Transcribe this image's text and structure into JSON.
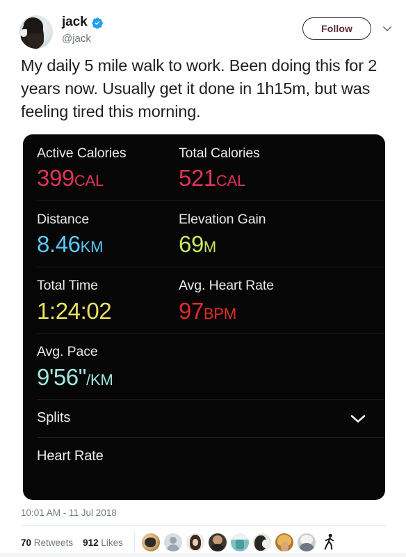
{
  "author": {
    "display_name": "jack",
    "handle": "@jack",
    "verified": true,
    "verified_color": "#1da1f2"
  },
  "follow": {
    "label": "Follow",
    "text_color": "#5a2831"
  },
  "tweet": {
    "text": "My daily 5 mile walk to work. Been doing this for 2 years now. Usually get it done in 1h15m, but was feeling tired this morning.",
    "timestamp": "10:01 AM - 11 Jul 2018"
  },
  "engagement": {
    "retweets_count": "70",
    "retweets_label": "Retweets",
    "likes_count": "912",
    "likes_label": "Likes",
    "facepile_count": 8,
    "activity_icon": "walking-person-icon"
  },
  "workout_card": {
    "background": "#060606",
    "metrics": [
      {
        "label": "Active Calories",
        "number": "399",
        "unit": "CAL",
        "color": "#e0335c"
      },
      {
        "label": "Total Calories",
        "number": "521",
        "unit": "CAL",
        "color": "#e0335c"
      },
      {
        "label": "Distance",
        "number": "8.46",
        "unit": "KM",
        "color": "#5ac8f5"
      },
      {
        "label": "Elevation Gain",
        "number": "69",
        "unit": "M",
        "color": "#c5e860"
      },
      {
        "label": "Total Time",
        "number": "1:24:02",
        "unit": "",
        "color": "#e8e15c"
      },
      {
        "label": "Avg. Heart Rate",
        "number": "97",
        "unit": "BPM",
        "color": "#e32b26"
      },
      {
        "label": "Avg. Pace",
        "number": "9'56\"",
        "unit": "/KM",
        "color": "#9ee8e0"
      }
    ],
    "sections": [
      {
        "label": "Splits",
        "expandable": true
      },
      {
        "label": "Heart Rate",
        "expandable": false
      }
    ]
  }
}
